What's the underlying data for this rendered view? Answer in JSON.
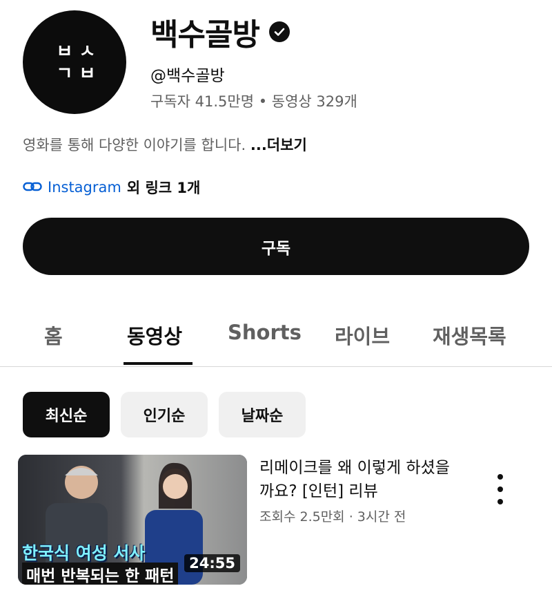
{
  "channel": {
    "avatar_glyphs": [
      "ㅂ",
      "ㅅ",
      "ㄱ",
      "ㅂ"
    ],
    "name": "백수골방",
    "verified_icon": "verified-check-icon",
    "handle": "@백수골방",
    "stats": "구독자 41.5만명 • 동영상 329개",
    "description": "영화를 통해 다양한 이야기를 합니다.",
    "more_label": "...더보기",
    "link_icon": "link-icon",
    "link_text": "Instagram",
    "link_rest": "외 링크 1개"
  },
  "subscribe_label": "구독",
  "tabs": [
    {
      "label": "홈",
      "active": false
    },
    {
      "label": "동영상",
      "active": true
    },
    {
      "label": "Shorts",
      "active": false
    },
    {
      "label": "라이브",
      "active": false
    },
    {
      "label": "재생목록",
      "active": false
    }
  ],
  "sort_chips": [
    {
      "label": "최신순",
      "active": true
    },
    {
      "label": "인기순",
      "active": false
    },
    {
      "label": "날짜순",
      "active": false
    }
  ],
  "videos": [
    {
      "thumbnail_text_1": "한국식 여성 서사",
      "thumbnail_text_2": "매번 반복되는 한 패턴",
      "duration": "24:55",
      "title": "리메이크를 왜 이렇게 하셨을까요? [인턴] 리뷰",
      "meta": "조회수 2.5만회 · 3시간 전",
      "menu_icon": "more-vert-icon"
    }
  ],
  "colors": {
    "text_primary": "#0f0f0f",
    "text_secondary": "#606060",
    "link": "#065fd4",
    "button_bg": "#0f0f0f",
    "chip_inactive_bg": "#f0f0f0"
  }
}
